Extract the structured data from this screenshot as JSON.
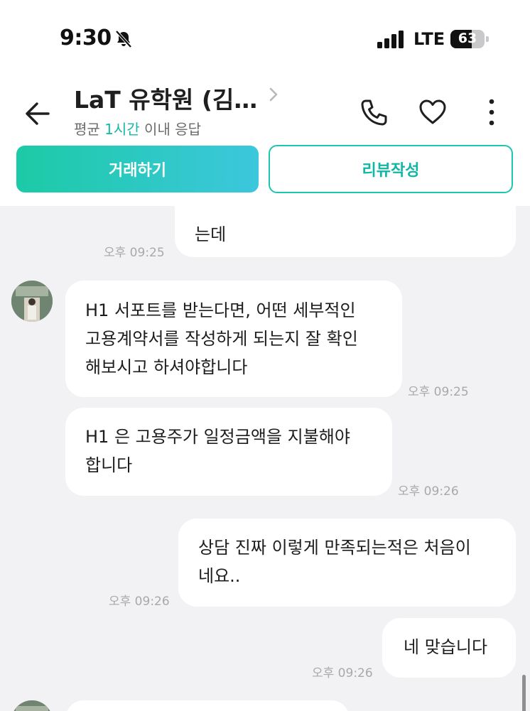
{
  "status_bar": {
    "time": "9:30",
    "network": "LTE",
    "battery": "63",
    "battery_level": 0.63
  },
  "header": {
    "title": "LaT 유학원 (김…",
    "subtitle_prefix": "평균 ",
    "subtitle_highlight": "1시간",
    "subtitle_suffix": " 이내 응답",
    "primary_button": "거래하기",
    "secondary_button": "리뷰작성",
    "icons": [
      "back-arrow-icon",
      "chevron-right-icon",
      "phone-icon",
      "heart-icon",
      "more-vertical-icon"
    ]
  },
  "messages": [
    {
      "sender": "me",
      "lines": [
        "는데"
      ],
      "time": "오후 09:25"
    },
    {
      "sender": "other",
      "lines": [
        "H1 서포트를 받는다면, 어떤 세부적인",
        "고용계약서를 작성하게 되는지 잘 확인",
        "해보시고 하셔야합니다"
      ],
      "time": "오후 09:25"
    },
    {
      "sender": "other",
      "lines": [
        "H1 은 고용주가 일정금액을 지불해야",
        "합니다"
      ],
      "time": "오후 09:26"
    },
    {
      "sender": "me",
      "lines": [
        "상담 진짜 이렇게 만족되는적은 처음이",
        "네요.."
      ],
      "time": "오후 09:26"
    },
    {
      "sender": "me",
      "lines": [
        "네 맞습니다"
      ],
      "time": "오후 09:26"
    }
  ],
  "colors": {
    "accent": "#1ec5b0",
    "background": "#f2f2f4",
    "bubble": "#ffffff",
    "timestamp": "#a8a8ad"
  }
}
